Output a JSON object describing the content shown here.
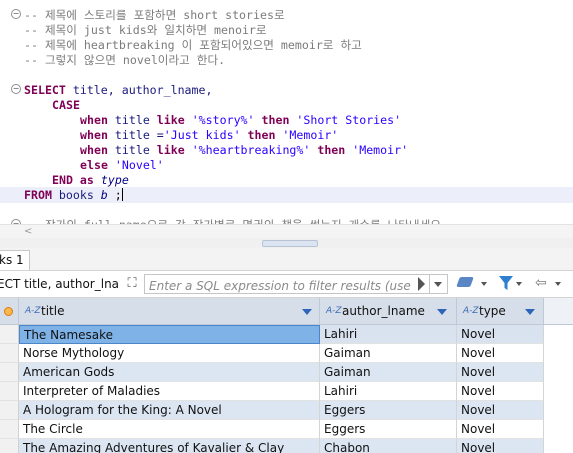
{
  "editor": {
    "comments": [
      "-- 제목에 스토리를 포함하면 short stories로",
      "-- 제목이 just kids와 일치하면 menoir로",
      "-- 제목에 heartbreaking 이 포함되어있으면 memoir로 하고",
      "-- 그렇지 않으면 novel이라고 한다."
    ],
    "sql": {
      "select_kw": "SELECT",
      "select_cols": " title, author_lname,",
      "case_kw": "CASE",
      "when1_kw": "when",
      "when1_col": " title ",
      "when1_like": "like",
      "when1_val": " '%story%' ",
      "when1_then": "then",
      "when1_res": " 'Short Stories'",
      "when2_kw": "when",
      "when2_col": " title =",
      "when2_val": "'Just kids' ",
      "when2_then": "then",
      "when2_res": " 'Memoir'",
      "when3_kw": "when",
      "when3_col": " title ",
      "when3_like": "like",
      "when3_val": " '%heartbreaking%' ",
      "when3_then": "then",
      "when3_res": " 'Memoir'",
      "else_kw": "else",
      "else_res": " 'Novel'",
      "end_kw": "END",
      "as_kw": " as ",
      "alias": "type",
      "from_kw": "FROM",
      "from_table": " books ",
      "from_alias": "b",
      "from_end": " ;"
    },
    "next_comment_partial": "-- 작가의 full name으로 각 작가별로 몇권의 책을 썼는지 개수를 나타내세요"
  },
  "results": {
    "tab_label": "ks 1",
    "query_text": "ECT title, author_lnam",
    "filter_placeholder": "Enter a SQL expression to filter results (use Ctrl+Space)",
    "columns": [
      {
        "label": "title"
      },
      {
        "label": "author_lname"
      },
      {
        "label": "type"
      }
    ],
    "rows": [
      [
        "The Namesake",
        "Lahiri",
        "Novel"
      ],
      [
        "Norse Mythology",
        "Gaiman",
        "Novel"
      ],
      [
        "American Gods",
        "Gaiman",
        "Novel"
      ],
      [
        "Interpreter of Maladies",
        "Lahiri",
        "Novel"
      ],
      [
        "A Hologram for the King: A Novel",
        "Eggers",
        "Novel"
      ],
      [
        "The Circle",
        "Eggers",
        "Novel"
      ],
      [
        "The Amazing Adventures of Kavalier & Clay",
        "Chabon",
        "Novel"
      ]
    ]
  },
  "colors": {
    "keyword": "#7f0055",
    "string": "#2a00ff",
    "comment": "#7b7b7b",
    "selection": "#7fb3e8",
    "header": "#d6dee9"
  }
}
